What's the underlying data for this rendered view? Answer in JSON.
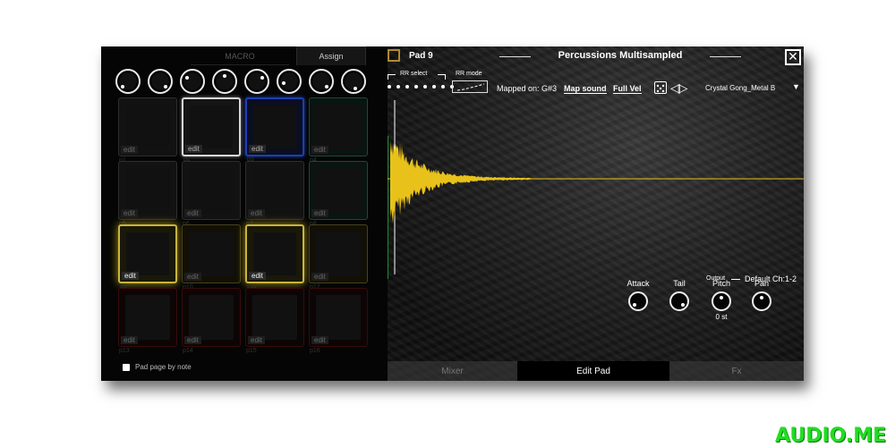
{
  "left": {
    "macro_tab": "MACRO",
    "assign_tab": "Assign",
    "knobs": [
      "knob",
      "knob",
      "knob",
      "knob",
      "knob",
      "knob",
      "knob",
      "knob"
    ],
    "pads": [
      {
        "edit": "edit",
        "label": "p1",
        "style": "dim"
      },
      {
        "edit": "edit",
        "label": "p2",
        "style": "white"
      },
      {
        "edit": "edit",
        "label": "p3",
        "style": "blue"
      },
      {
        "edit": "edit",
        "label": "p4",
        "style": "green"
      },
      {
        "edit": "edit",
        "label": "p5",
        "style": "dim"
      },
      {
        "edit": "edit",
        "label": "p6",
        "style": "dim"
      },
      {
        "edit": "edit",
        "label": "p7",
        "style": "dim"
      },
      {
        "edit": "edit",
        "label": "p8",
        "style": "green"
      },
      {
        "edit": "edit",
        "label": "p9",
        "style": "gold"
      },
      {
        "edit": "edit",
        "label": "p10",
        "style": "gold-dim"
      },
      {
        "edit": "edit",
        "label": "p11",
        "style": "gold"
      },
      {
        "edit": "edit",
        "label": "p12",
        "style": "gold-dim"
      },
      {
        "edit": "edit",
        "label": "p13",
        "style": "red"
      },
      {
        "edit": "edit",
        "label": "p14",
        "style": "red"
      },
      {
        "edit": "edit",
        "label": "p15",
        "style": "red"
      },
      {
        "edit": "edit",
        "label": "p16",
        "style": "red"
      }
    ],
    "pad_page_by_note": "Pad page by note"
  },
  "right": {
    "pad_title": "Pad 9",
    "title": "Percussions Multisampled",
    "close_icon": "close-icon",
    "rr_select": "RR select",
    "rr_mode": "RR mode",
    "mapped_on": "Mapped on: G#3",
    "map_sound": "Map sound",
    "full_vel": "Full Vel",
    "sample_name": "Crystal Gong_Metal B",
    "controls": [
      {
        "label": "Attack",
        "value": ""
      },
      {
        "label": "Tail",
        "value": ""
      },
      {
        "label": "Pitch",
        "value": "0 st"
      },
      {
        "label": "Pan",
        "value": ""
      }
    ],
    "output_label": "Output",
    "output_value": "Default Ch:1-2",
    "tabs": {
      "mixer": "Mixer",
      "edit_pad": "Edit Pad",
      "fx": "Fx"
    }
  },
  "colors": {
    "waveform": "#e8c21a",
    "pad_active": "#c9b53a",
    "logo": "#22dd22"
  },
  "watermark": "AUDIO.ME"
}
